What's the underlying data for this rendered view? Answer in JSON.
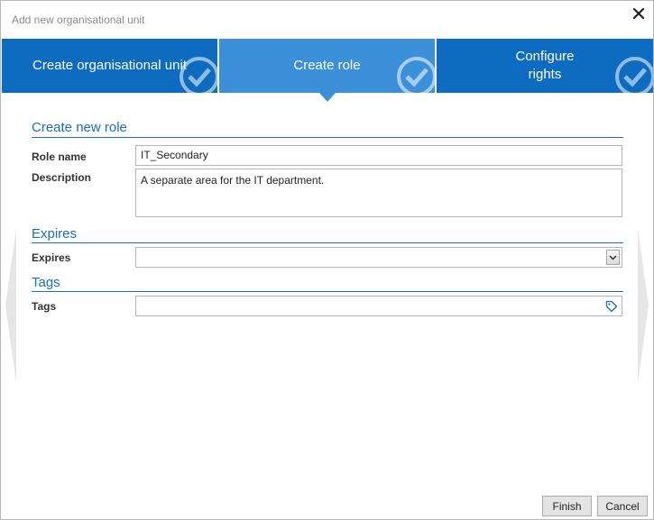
{
  "dialog": {
    "title": "Add new organisational unit"
  },
  "icons": {
    "close": "close-icon",
    "step_complete": "check-circle-icon",
    "dropdown": "chevron-down-icon",
    "tag": "tag-icon",
    "nav_prev": "arrow-left-icon",
    "nav_next": "arrow-right-icon"
  },
  "steps": [
    {
      "label": "Create organisational unit",
      "state": "complete"
    },
    {
      "label": "Create role",
      "state": "active"
    },
    {
      "label": "Configure rights",
      "state": "pending"
    }
  ],
  "sections": {
    "role": {
      "title": "Create new role",
      "role_name_label": "Role name",
      "role_name_value": "IT_Secondary",
      "description_label": "Description",
      "description_value": "A separate area for the IT department."
    },
    "expires": {
      "title": "Expires",
      "label": "Expires",
      "value": ""
    },
    "tags": {
      "title": "Tags",
      "label": "Tags",
      "value": ""
    }
  },
  "buttons": {
    "finish": "Finish",
    "cancel": "Cancel"
  },
  "colors": {
    "step_bg": "#0d6cbf",
    "step_active_bg": "#3b90d9",
    "accent": "#1b6eb7"
  }
}
